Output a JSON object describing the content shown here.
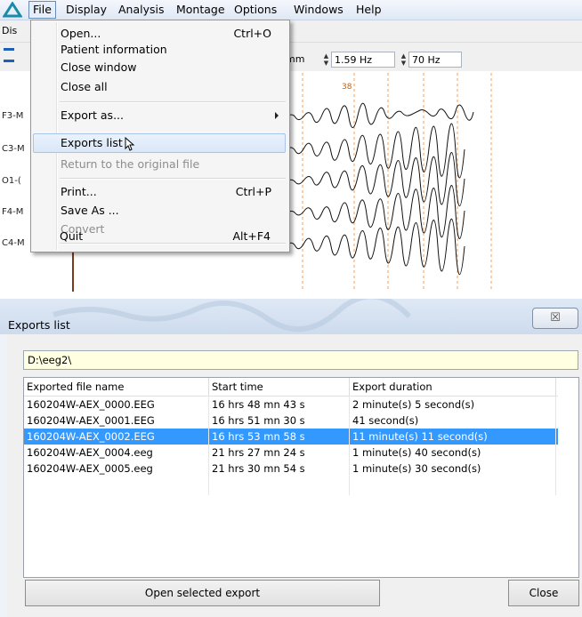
{
  "menubar": {
    "items": [
      "File",
      "Display",
      "Analysis",
      "Montage",
      "Options",
      "Windows",
      "Help"
    ]
  },
  "toolbar": {
    "row1_label": "Dis",
    "sensitivity_unit": "mm",
    "low_filter": "1.59 Hz",
    "high_filter": "70 Hz"
  },
  "eeg": {
    "channels": [
      "F3-M",
      "C3-M",
      "O1-(",
      "F4-M",
      "C4-M"
    ],
    "marker_label": "38"
  },
  "file_menu": {
    "items": [
      {
        "label": "Open...",
        "shortcut": "Ctrl+O"
      },
      {
        "label": "Patient information",
        "shortcut": ""
      },
      {
        "label": "Close window",
        "shortcut": ""
      },
      {
        "label": "Close all",
        "shortcut": ""
      },
      {
        "label": "Export as...",
        "shortcut": ""
      },
      {
        "label": "Exports list",
        "shortcut": ""
      },
      {
        "label": "Return to the original file",
        "shortcut": ""
      },
      {
        "label": "Print...",
        "shortcut": "Ctrl+P"
      },
      {
        "label": "Save As ...",
        "shortcut": ""
      },
      {
        "label": "Convert",
        "shortcut": ""
      },
      {
        "label": "Quit",
        "shortcut": "Alt+F4"
      }
    ]
  },
  "dialog": {
    "title": "Exports list",
    "close_glyph": "☒",
    "path": "D:\\eeg2\\",
    "columns": [
      "Exported file name",
      "Start time",
      "Export duration"
    ],
    "rows": [
      {
        "name": "160204W-AEX_0000.EEG",
        "start": "16 hrs 48 mn 43 s",
        "duration": "2 minute(s) 5 second(s)"
      },
      {
        "name": "160204W-AEX_0001.EEG",
        "start": "16 hrs 51 mn 30 s",
        "duration": "41 second(s)"
      },
      {
        "name": "160204W-AEX_0002.EEG",
        "start": "16 hrs 53 mn 58 s",
        "duration": "11 minute(s) 11 second(s)"
      },
      {
        "name": "160204W-AEX_0004.eeg",
        "start": "21 hrs 27 mn 24 s",
        "duration": "1 minute(s) 40 second(s)"
      },
      {
        "name": "160204W-AEX_0005.eeg",
        "start": "21 hrs 30 mn 54 s",
        "duration": "1 minute(s) 30 second(s)"
      }
    ],
    "open_button": "Open selected export",
    "close_button": "Close"
  }
}
